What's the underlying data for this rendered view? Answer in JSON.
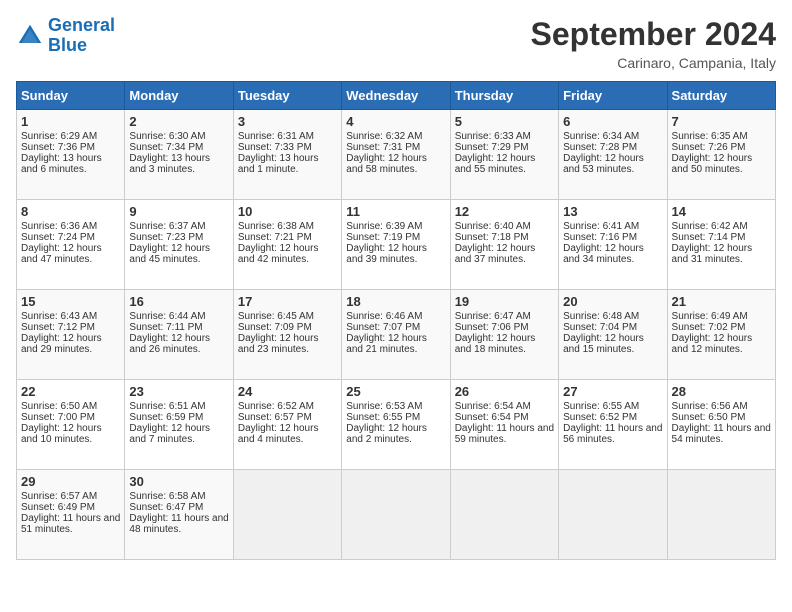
{
  "header": {
    "logo_line1": "General",
    "logo_line2": "Blue",
    "month_title": "September 2024",
    "location": "Carinaro, Campania, Italy"
  },
  "days_of_week": [
    "Sunday",
    "Monday",
    "Tuesday",
    "Wednesday",
    "Thursday",
    "Friday",
    "Saturday"
  ],
  "weeks": [
    [
      {
        "day": "1",
        "sunrise": "Sunrise: 6:29 AM",
        "sunset": "Sunset: 7:36 PM",
        "daylight": "Daylight: 13 hours and 6 minutes."
      },
      {
        "day": "2",
        "sunrise": "Sunrise: 6:30 AM",
        "sunset": "Sunset: 7:34 PM",
        "daylight": "Daylight: 13 hours and 3 minutes."
      },
      {
        "day": "3",
        "sunrise": "Sunrise: 6:31 AM",
        "sunset": "Sunset: 7:33 PM",
        "daylight": "Daylight: 13 hours and 1 minute."
      },
      {
        "day": "4",
        "sunrise": "Sunrise: 6:32 AM",
        "sunset": "Sunset: 7:31 PM",
        "daylight": "Daylight: 12 hours and 58 minutes."
      },
      {
        "day": "5",
        "sunrise": "Sunrise: 6:33 AM",
        "sunset": "Sunset: 7:29 PM",
        "daylight": "Daylight: 12 hours and 55 minutes."
      },
      {
        "day": "6",
        "sunrise": "Sunrise: 6:34 AM",
        "sunset": "Sunset: 7:28 PM",
        "daylight": "Daylight: 12 hours and 53 minutes."
      },
      {
        "day": "7",
        "sunrise": "Sunrise: 6:35 AM",
        "sunset": "Sunset: 7:26 PM",
        "daylight": "Daylight: 12 hours and 50 minutes."
      }
    ],
    [
      {
        "day": "8",
        "sunrise": "Sunrise: 6:36 AM",
        "sunset": "Sunset: 7:24 PM",
        "daylight": "Daylight: 12 hours and 47 minutes."
      },
      {
        "day": "9",
        "sunrise": "Sunrise: 6:37 AM",
        "sunset": "Sunset: 7:23 PM",
        "daylight": "Daylight: 12 hours and 45 minutes."
      },
      {
        "day": "10",
        "sunrise": "Sunrise: 6:38 AM",
        "sunset": "Sunset: 7:21 PM",
        "daylight": "Daylight: 12 hours and 42 minutes."
      },
      {
        "day": "11",
        "sunrise": "Sunrise: 6:39 AM",
        "sunset": "Sunset: 7:19 PM",
        "daylight": "Daylight: 12 hours and 39 minutes."
      },
      {
        "day": "12",
        "sunrise": "Sunrise: 6:40 AM",
        "sunset": "Sunset: 7:18 PM",
        "daylight": "Daylight: 12 hours and 37 minutes."
      },
      {
        "day": "13",
        "sunrise": "Sunrise: 6:41 AM",
        "sunset": "Sunset: 7:16 PM",
        "daylight": "Daylight: 12 hours and 34 minutes."
      },
      {
        "day": "14",
        "sunrise": "Sunrise: 6:42 AM",
        "sunset": "Sunset: 7:14 PM",
        "daylight": "Daylight: 12 hours and 31 minutes."
      }
    ],
    [
      {
        "day": "15",
        "sunrise": "Sunrise: 6:43 AM",
        "sunset": "Sunset: 7:12 PM",
        "daylight": "Daylight: 12 hours and 29 minutes."
      },
      {
        "day": "16",
        "sunrise": "Sunrise: 6:44 AM",
        "sunset": "Sunset: 7:11 PM",
        "daylight": "Daylight: 12 hours and 26 minutes."
      },
      {
        "day": "17",
        "sunrise": "Sunrise: 6:45 AM",
        "sunset": "Sunset: 7:09 PM",
        "daylight": "Daylight: 12 hours and 23 minutes."
      },
      {
        "day": "18",
        "sunrise": "Sunrise: 6:46 AM",
        "sunset": "Sunset: 7:07 PM",
        "daylight": "Daylight: 12 hours and 21 minutes."
      },
      {
        "day": "19",
        "sunrise": "Sunrise: 6:47 AM",
        "sunset": "Sunset: 7:06 PM",
        "daylight": "Daylight: 12 hours and 18 minutes."
      },
      {
        "day": "20",
        "sunrise": "Sunrise: 6:48 AM",
        "sunset": "Sunset: 7:04 PM",
        "daylight": "Daylight: 12 hours and 15 minutes."
      },
      {
        "day": "21",
        "sunrise": "Sunrise: 6:49 AM",
        "sunset": "Sunset: 7:02 PM",
        "daylight": "Daylight: 12 hours and 12 minutes."
      }
    ],
    [
      {
        "day": "22",
        "sunrise": "Sunrise: 6:50 AM",
        "sunset": "Sunset: 7:00 PM",
        "daylight": "Daylight: 12 hours and 10 minutes."
      },
      {
        "day": "23",
        "sunrise": "Sunrise: 6:51 AM",
        "sunset": "Sunset: 6:59 PM",
        "daylight": "Daylight: 12 hours and 7 minutes."
      },
      {
        "day": "24",
        "sunrise": "Sunrise: 6:52 AM",
        "sunset": "Sunset: 6:57 PM",
        "daylight": "Daylight: 12 hours and 4 minutes."
      },
      {
        "day": "25",
        "sunrise": "Sunrise: 6:53 AM",
        "sunset": "Sunset: 6:55 PM",
        "daylight": "Daylight: 12 hours and 2 minutes."
      },
      {
        "day": "26",
        "sunrise": "Sunrise: 6:54 AM",
        "sunset": "Sunset: 6:54 PM",
        "daylight": "Daylight: 11 hours and 59 minutes."
      },
      {
        "day": "27",
        "sunrise": "Sunrise: 6:55 AM",
        "sunset": "Sunset: 6:52 PM",
        "daylight": "Daylight: 11 hours and 56 minutes."
      },
      {
        "day": "28",
        "sunrise": "Sunrise: 6:56 AM",
        "sunset": "Sunset: 6:50 PM",
        "daylight": "Daylight: 11 hours and 54 minutes."
      }
    ],
    [
      {
        "day": "29",
        "sunrise": "Sunrise: 6:57 AM",
        "sunset": "Sunset: 6:49 PM",
        "daylight": "Daylight: 11 hours and 51 minutes."
      },
      {
        "day": "30",
        "sunrise": "Sunrise: 6:58 AM",
        "sunset": "Sunset: 6:47 PM",
        "daylight": "Daylight: 11 hours and 48 minutes."
      },
      null,
      null,
      null,
      null,
      null
    ]
  ]
}
